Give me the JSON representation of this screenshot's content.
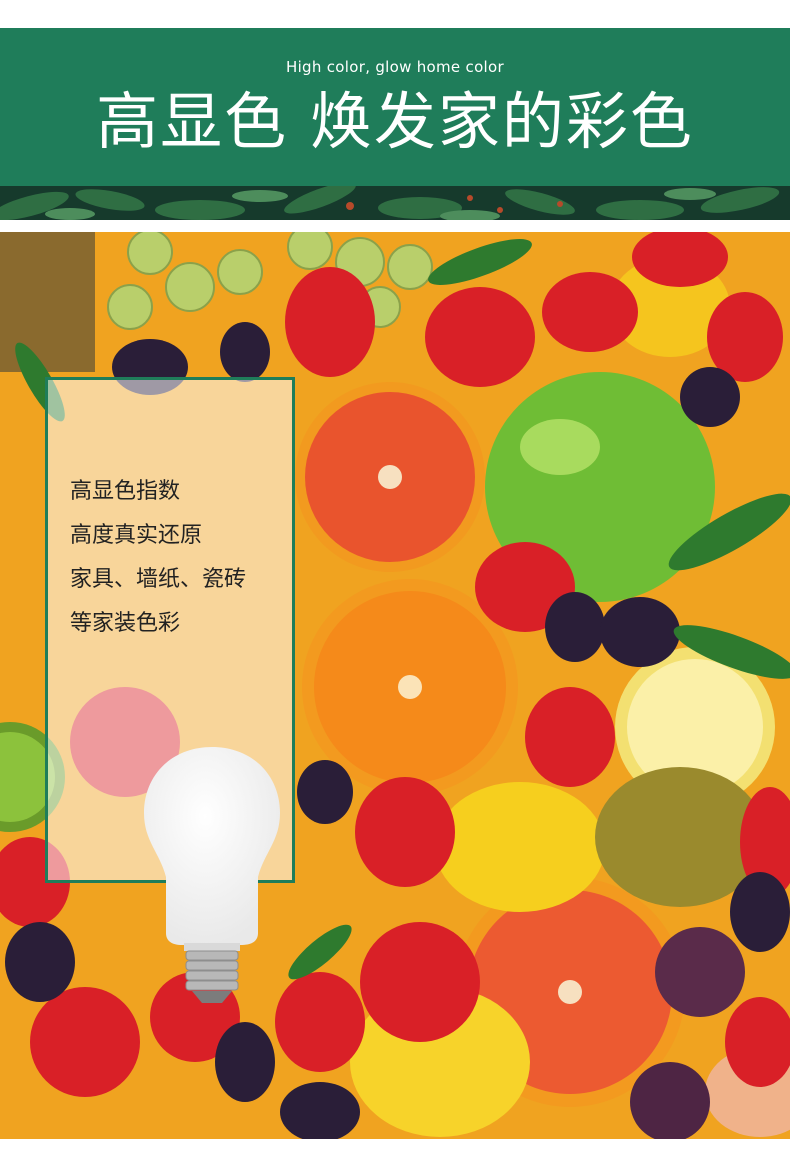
{
  "header": {
    "subtitle": "High color, glow home color",
    "title": "高显色 焕发家的彩色",
    "background_color": "#1f7d5a"
  },
  "feature_panel": {
    "lines": [
      "高显色指数",
      "高度真实还原",
      "家具、墙纸、瓷砖",
      "等家装色彩"
    ],
    "border_color": "#1f7d5a"
  },
  "images": {
    "banner_strip": "tropical-leaves",
    "photo": "assorted-fruits",
    "product": "led-bulb"
  }
}
